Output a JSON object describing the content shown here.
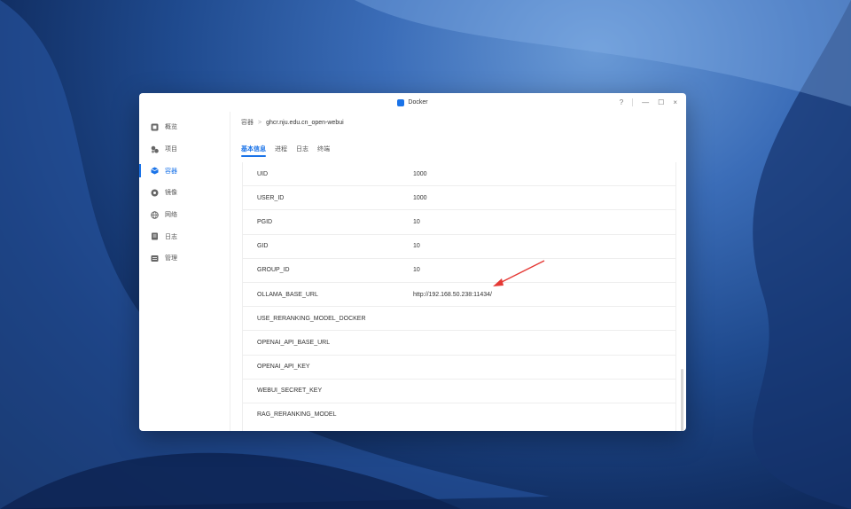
{
  "window": {
    "title": "Docker",
    "controls": {
      "help": "?",
      "minimize": "—",
      "maximize": "☐",
      "close": "×"
    }
  },
  "sidebar": {
    "items": [
      {
        "label": "概览",
        "icon": "overview-icon",
        "active": false
      },
      {
        "label": "项目",
        "icon": "project-icon",
        "active": false
      },
      {
        "label": "容器",
        "icon": "container-icon",
        "active": true
      },
      {
        "label": "镜像",
        "icon": "image-icon",
        "active": false
      },
      {
        "label": "网络",
        "icon": "network-icon",
        "active": false
      },
      {
        "label": "日志",
        "icon": "log-icon",
        "active": false
      },
      {
        "label": "管理",
        "icon": "manage-icon",
        "active": false
      }
    ]
  },
  "breadcrumb": {
    "root": "容器",
    "separator": ">",
    "current": "ghcr.nju.edu.cn_open-webui"
  },
  "tabs": [
    {
      "label": "基本信息",
      "active": true
    },
    {
      "label": "进程",
      "active": false
    },
    {
      "label": "日志",
      "active": false
    },
    {
      "label": "终端",
      "active": false
    }
  ],
  "env_rows": [
    {
      "key": "UID",
      "value": "1000"
    },
    {
      "key": "USER_ID",
      "value": "1000"
    },
    {
      "key": "PGID",
      "value": "10"
    },
    {
      "key": "GID",
      "value": "10"
    },
    {
      "key": "GROUP_ID",
      "value": "10"
    },
    {
      "key": "OLLAMA_BASE_URL",
      "value": "http://192.168.50.238:11434/"
    },
    {
      "key": "USE_RERANKING_MODEL_DOCKER",
      "value": ""
    },
    {
      "key": "OPENAI_API_BASE_URL",
      "value": ""
    },
    {
      "key": "OPENAI_API_KEY",
      "value": ""
    },
    {
      "key": "WEBUI_SECRET_KEY",
      "value": ""
    },
    {
      "key": "RAG_RERANKING_MODEL",
      "value": ""
    }
  ],
  "colors": {
    "accent": "#1a73e8",
    "annotation_arrow": "#e53935"
  }
}
